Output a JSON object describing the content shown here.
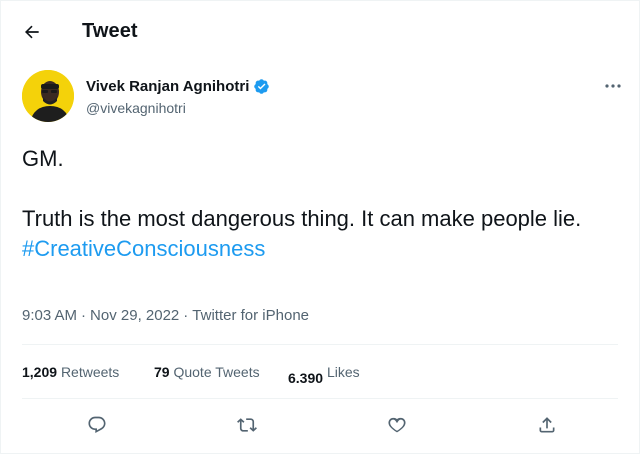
{
  "header": {
    "title": "Tweet",
    "back_icon": "arrow-left-icon"
  },
  "author": {
    "name": "Vivek Ranjan Agnihotri",
    "handle": "@vivekagnihotri",
    "verified_icon": "verified-badge-icon",
    "avatar_color": "#f4d20a"
  },
  "tweet": {
    "line1": "GM.",
    "line2": "Truth is the most dangerous thing. It can make people lie.",
    "hashtag": "#CreativeConsciousness"
  },
  "meta": {
    "time": "9:03 AM",
    "sep1": "·",
    "date": "Nov 29, 2022",
    "sep2": "·",
    "source": "Twitter for iPhone"
  },
  "stats": {
    "retweets_count": "1,209",
    "retweets_label": "Retweets",
    "quotes_count": "79",
    "quotes_label": "Quote Tweets",
    "likes_count": "6.390",
    "likes_label": "Likes"
  },
  "colors": {
    "accent": "#1d9bf0",
    "text": "#0f1419",
    "muted": "#536471"
  },
  "actions": [
    "reply-icon",
    "retweet-icon",
    "like-icon",
    "share-icon"
  ]
}
